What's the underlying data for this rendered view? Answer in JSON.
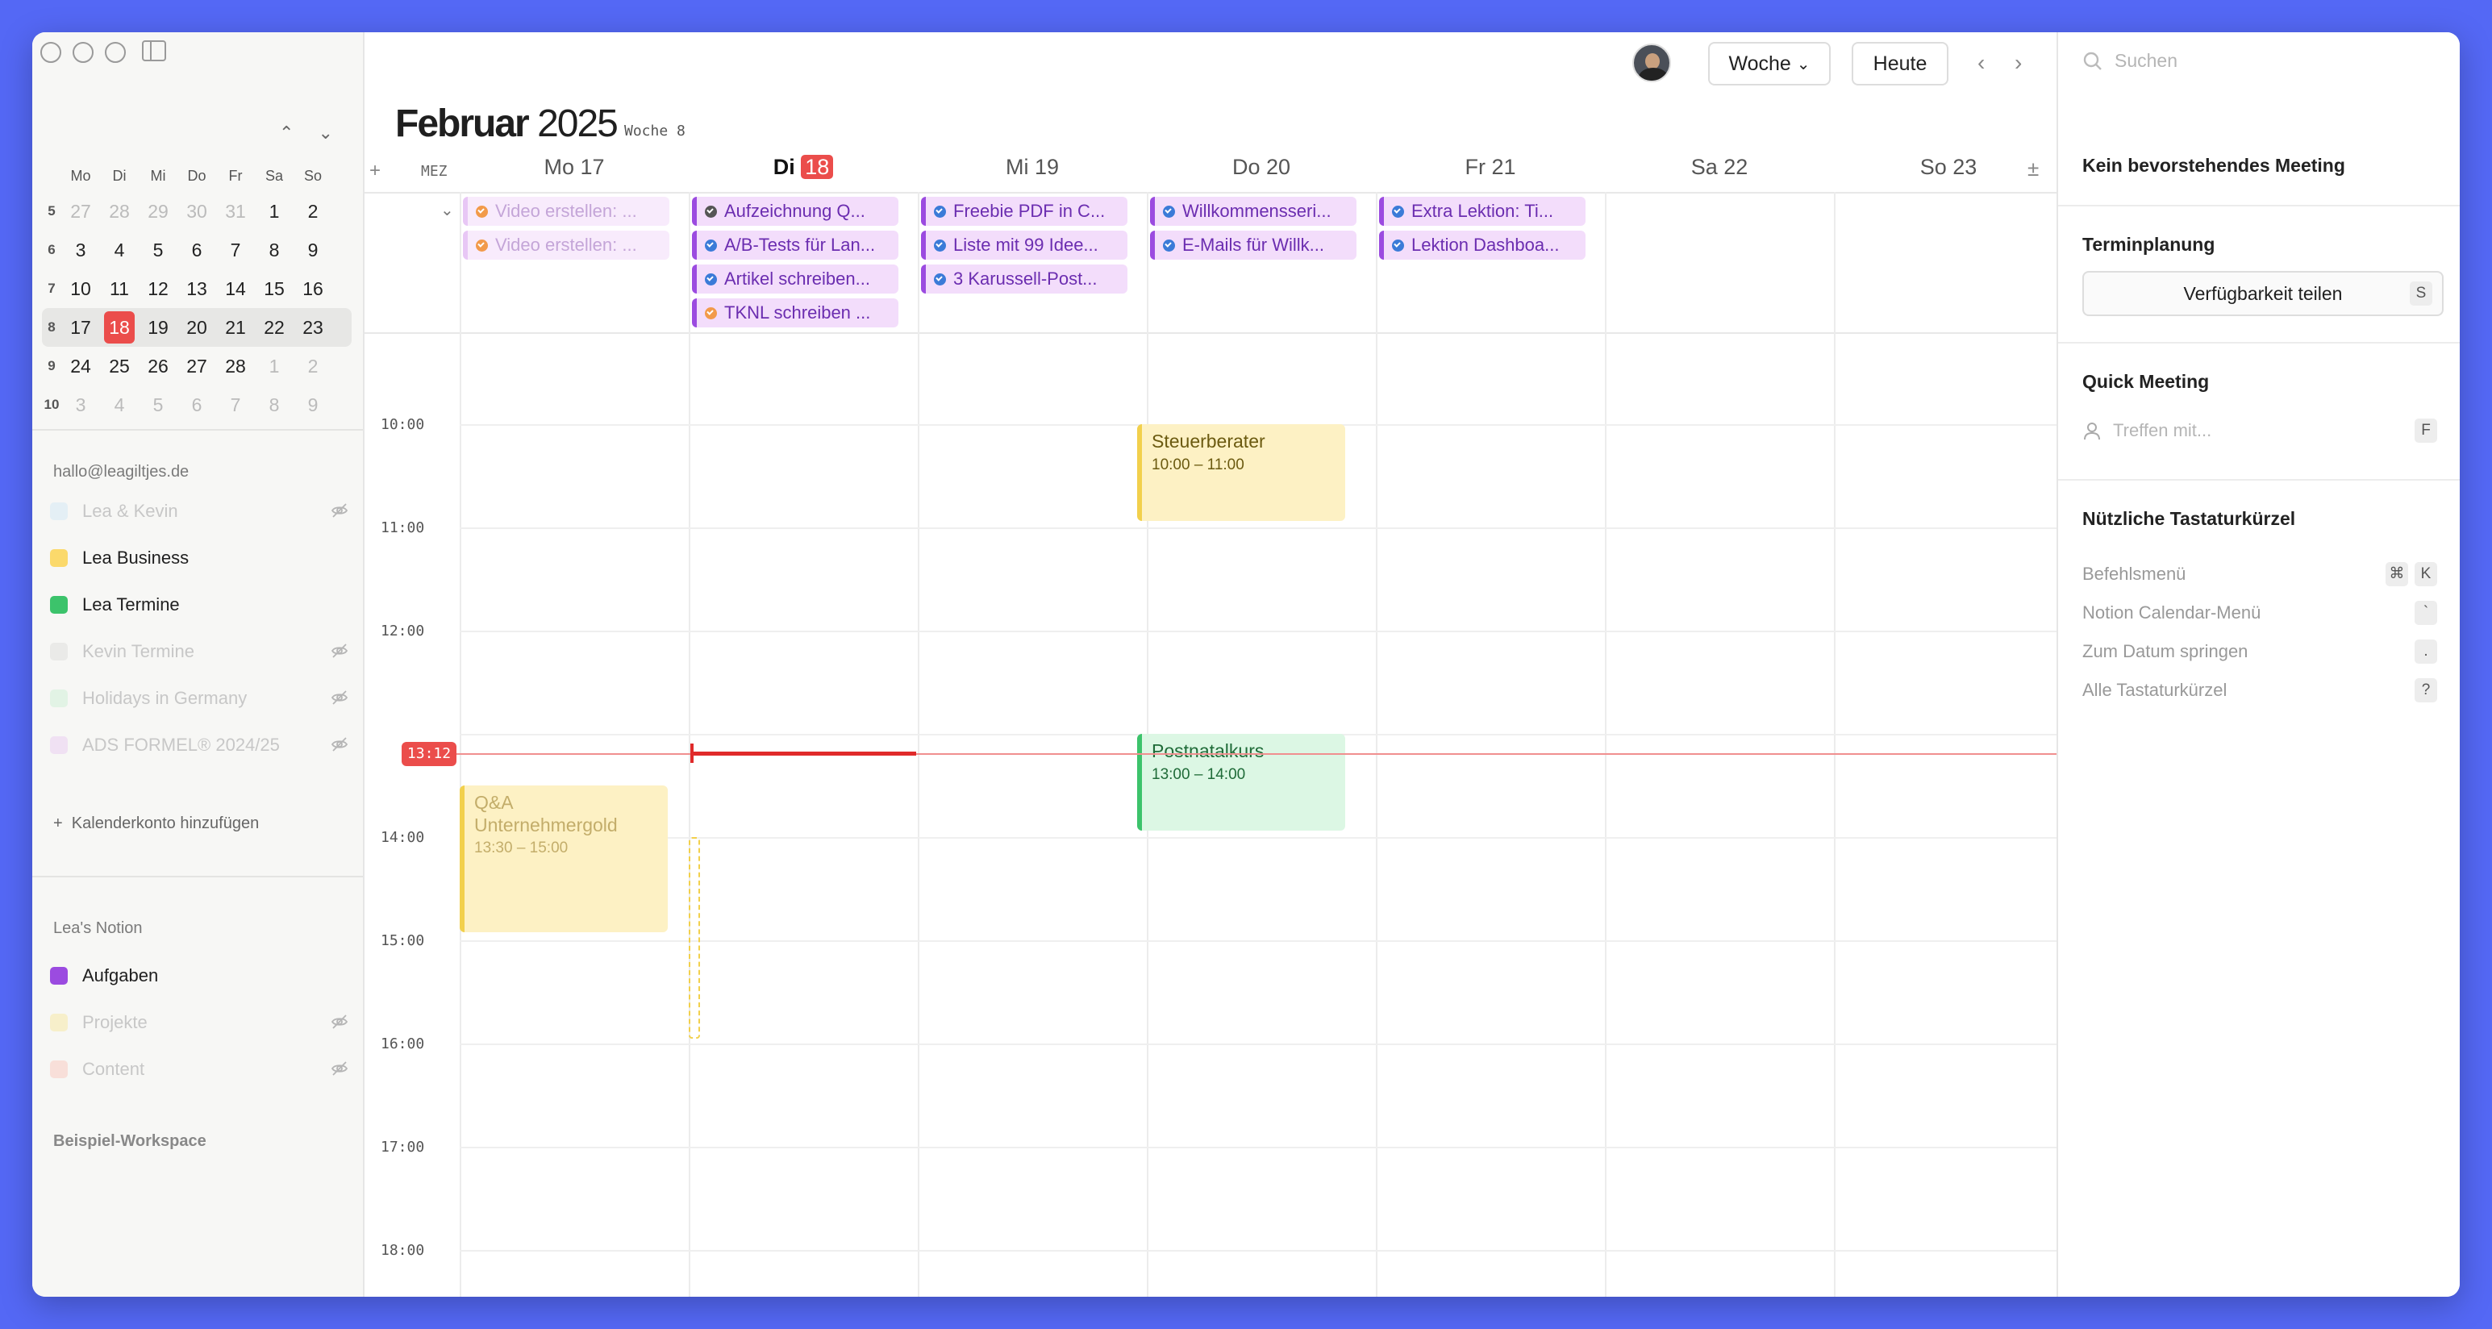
{
  "sidebar": {
    "mini_cal": {
      "weekdays": [
        "Mo",
        "Di",
        "Mi",
        "Do",
        "Fr",
        "Sa",
        "So"
      ],
      "weeks": [
        {
          "wk": "5",
          "days": [
            "27",
            "28",
            "29",
            "30",
            "31",
            "1",
            "2"
          ]
        },
        {
          "wk": "6",
          "days": [
            "3",
            "4",
            "5",
            "6",
            "7",
            "8",
            "9"
          ]
        },
        {
          "wk": "7",
          "days": [
            "10",
            "11",
            "12",
            "13",
            "14",
            "15",
            "16"
          ]
        },
        {
          "wk": "8",
          "days": [
            "17",
            "18",
            "19",
            "20",
            "21",
            "22",
            "23"
          ]
        },
        {
          "wk": "9",
          "days": [
            "24",
            "25",
            "26",
            "27",
            "28",
            "1",
            "2"
          ]
        },
        {
          "wk": "10",
          "days": [
            "3",
            "4",
            "5",
            "6",
            "7",
            "8",
            "9"
          ]
        }
      ]
    },
    "account": "hallo@leagiltjes.de",
    "calendars": [
      {
        "name": "Lea & Kevin",
        "color": "#bfe0f5",
        "hidden": true
      },
      {
        "name": "Lea Business",
        "color": "#fbd96b",
        "hidden": false
      },
      {
        "name": "Lea Termine",
        "color": "#3cc36b",
        "hidden": false
      },
      {
        "name": "Kevin Termine",
        "color": "#d0d0d0",
        "hidden": true
      },
      {
        "name": "Holidays in Germany",
        "color": "#b9ecc9",
        "hidden": true
      },
      {
        "name": "ADS FORMEL® 2024/25",
        "color": "#e2b8f0",
        "hidden": true
      }
    ],
    "add_calendar": "Kalenderkonto hinzufügen",
    "notion_section": "Lea's Notion",
    "notion_dbs": [
      {
        "name": "Aufgaben",
        "color": "#9b4be0",
        "hidden": false
      },
      {
        "name": "Projekte",
        "color": "#f7df7a",
        "hidden": true
      },
      {
        "name": "Content",
        "color": "#f8b3a5",
        "hidden": true
      }
    ],
    "workspace": "Beispiel-Workspace"
  },
  "header": {
    "view_label": "Woche",
    "today_label": "Heute",
    "month": "Februar",
    "year": "2025",
    "week_label": "Woche 8",
    "timezone": "MEZ",
    "days": [
      {
        "label": "Mo 17"
      },
      {
        "label": "Di",
        "num": "18"
      },
      {
        "label": "Mi 19"
      },
      {
        "label": "Do 20"
      },
      {
        "label": "Fr 21"
      },
      {
        "label": "Sa 22"
      },
      {
        "label": "So 23"
      }
    ]
  },
  "allday": [
    [
      {
        "t": "Video erstellen: ...",
        "faded": true,
        "c": "#f29a4a"
      },
      {
        "t": "Video erstellen: ...",
        "faded": true,
        "c": "#f29a4a"
      }
    ],
    [
      {
        "t": "Aufzeichnung Q...",
        "c": "#555"
      },
      {
        "t": "A/B-Tests für Lan...",
        "c": "#3b7bd8"
      },
      {
        "t": "Artikel schreiben...",
        "c": "#3b7bd8"
      },
      {
        "t": "TKNL schreiben ...",
        "c": "#f29a4a"
      }
    ],
    [
      {
        "t": "Freebie PDF in C...",
        "c": "#3b7bd8"
      },
      {
        "t": "Liste mit 99 Idee...",
        "c": "#3b7bd8"
      },
      {
        "t": "3 Karussell-Post...",
        "c": "#3b7bd8"
      }
    ],
    [
      {
        "t": "Willkommensseri...",
        "c": "#3b7bd8"
      },
      {
        "t": "E-Mails für Willk...",
        "c": "#3b7bd8"
      }
    ],
    [
      {
        "t": "Extra Lektion: Ti...",
        "c": "#3b7bd8"
      },
      {
        "t": "Lektion Dashboa...",
        "c": "#3b7bd8"
      }
    ],
    [],
    []
  ],
  "times": [
    "10:00",
    "11:00",
    "12:00",
    "13:00",
    "14:00",
    "15:00",
    "16:00",
    "17:00",
    "18:00"
  ],
  "now": "13:12",
  "events": [
    {
      "title": "Steuerberater",
      "time": "10:00 – 11:00"
    },
    {
      "title": "Postnatalkurs",
      "time": "13:00 – 14:00"
    },
    {
      "title": "Q&A Unternehmergold",
      "time": "13:30 – 15:00"
    }
  ],
  "right": {
    "search_placeholder": "Suchen",
    "no_meeting": "Kein bevorstehendes Meeting",
    "scheduling": "Terminplanung",
    "share_label": "Verfügbarkeit teilen",
    "share_key": "S",
    "quick_meeting": "Quick Meeting",
    "quick_placeholder": "Treffen mit...",
    "quick_key": "F",
    "shortcuts_title": "Nützliche Tastaturkürzel",
    "shortcuts": [
      {
        "label": "Befehlsmenü",
        "keys": [
          "⌘",
          "K"
        ]
      },
      {
        "label": "Notion Calendar-Menü",
        "keys": [
          "`"
        ]
      },
      {
        "label": "Zum Datum springen",
        "keys": [
          "."
        ]
      },
      {
        "label": "Alle Tastaturkürzel",
        "keys": [
          "?"
        ]
      }
    ]
  }
}
